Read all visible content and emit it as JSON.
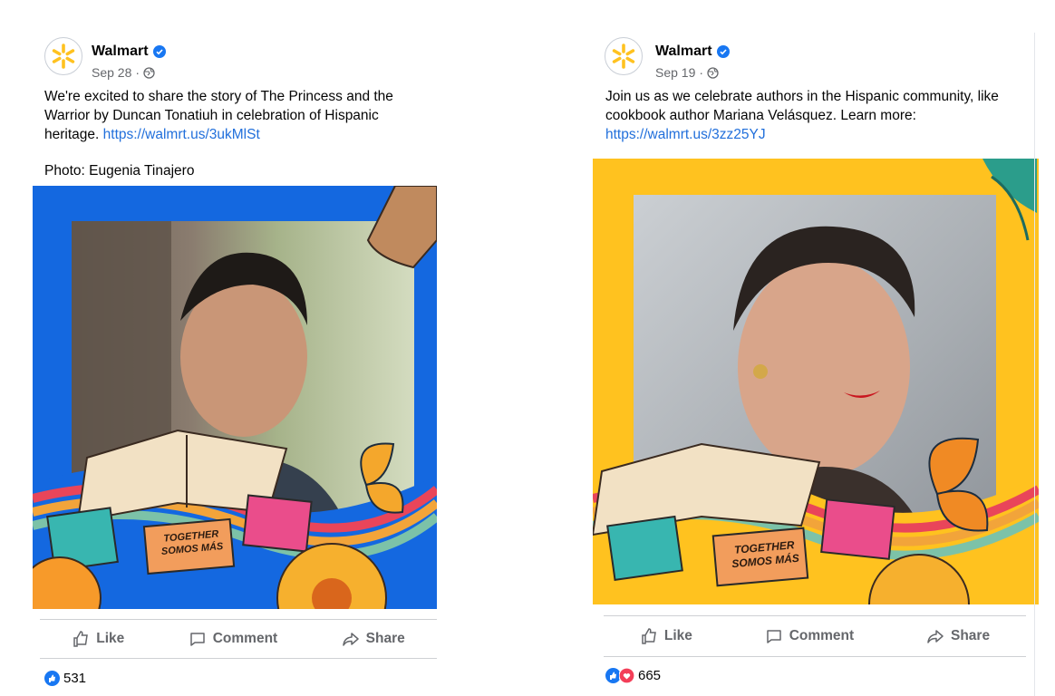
{
  "colors": {
    "walmart_blue": "#0071dc",
    "spark_yellow": "#ffc220",
    "link": "#216fdb",
    "verified": "#1877f2",
    "love_red": "#f33e58"
  },
  "posts": [
    {
      "page_name": "Walmart",
      "date": "Sep 28",
      "text": "We're excited to share the story of The Princess and the Warrior by Duncan Tonatiuh in celebration of Hispanic heritage.",
      "link": "https://walmrt.us/3ukMlSt",
      "photo_credit": "Photo: Eugenia Tinajero",
      "image_banner": "TOGETHER SOMOS MÁS",
      "actions": {
        "like": "Like",
        "comment": "Comment",
        "share": "Share"
      },
      "reaction_count": "531"
    },
    {
      "page_name": "Walmart",
      "date": "Sep 19",
      "text": "Join us as we celebrate authors in the Hispanic community, like cookbook author Mariana Velásquez. Learn more:",
      "link": "https://walmrt.us/3zz25YJ",
      "image_banner": "TOGETHER SOMOS MÁS",
      "actions": {
        "like": "Like",
        "comment": "Comment",
        "share": "Share"
      },
      "reaction_count": "665"
    }
  ]
}
